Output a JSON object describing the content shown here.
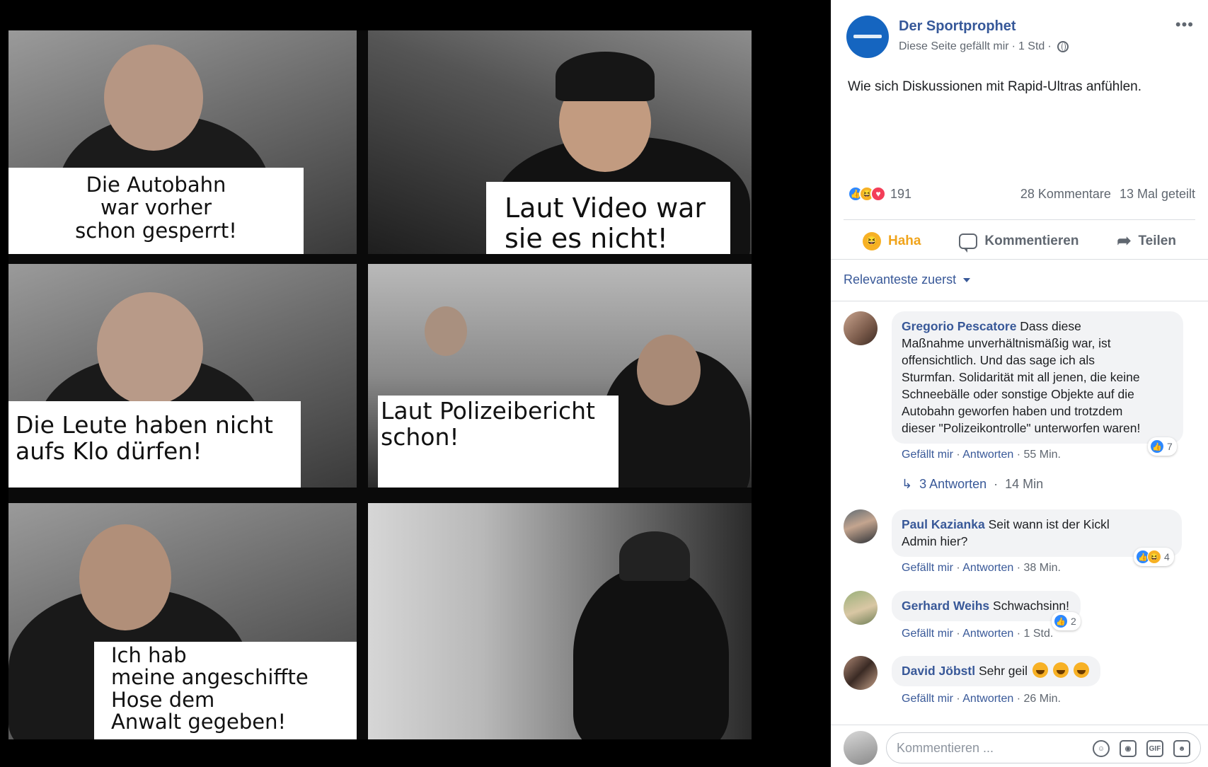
{
  "meme": {
    "captions": [
      {
        "lines": [
          "Die Autobahn",
          "war vorher",
          "schon gesperrt!"
        ]
      },
      {
        "lines": [
          "Laut Video war",
          "sie es nicht!"
        ]
      },
      {
        "lines": [
          "Die Leute haben nicht",
          "aufs Klo dürfen!"
        ]
      },
      {
        "lines": [
          "Laut Polizeibericht",
          "schon!"
        ]
      },
      {
        "lines": [
          "Ich hab",
          "meine angeschiffte",
          "Hose dem",
          "Anwalt gegeben!"
        ]
      }
    ]
  },
  "post": {
    "page_name": "Der Sportprophet",
    "like_page": "Diese Seite gefällt mir",
    "time": "1 Std",
    "text": "Wie sich Diskussionen mit Rapid-Ultras anfühlen.",
    "reaction_count": "191",
    "comment_count": "28 Kommentare",
    "share_count": "13 Mal geteilt"
  },
  "actions": {
    "haha": "Haha",
    "comment": "Kommentieren",
    "share": "Teilen"
  },
  "sort": "Relevanteste zuerst",
  "comments": [
    {
      "author": "Gregorio Pescatore",
      "lines": [
        "Dass diese",
        "Maßnahme unverhältnismäßig war, ist",
        "offensichtlich. Und das sage ich als",
        "Sturmfan. Solidarität mit all jenen, die keine",
        "Schneebälle oder sonstige Objekte auf die",
        "Autobahn geworfen haben und trotzdem",
        "dieser \"Polizeikontrolle\" unterworfen waren!"
      ],
      "like": "Gefällt mir",
      "reply": "Antworten",
      "time": "55 Min.",
      "reactions": "7",
      "replies": "3 Antworten",
      "replies_time": "14 Min"
    },
    {
      "author": "Paul Kazianka",
      "lines": [
        "Seit wann ist der Kickl",
        "Admin hier?"
      ],
      "like": "Gefällt mir",
      "reply": "Antworten",
      "time": "38 Min.",
      "reactions": "4"
    },
    {
      "author": "Gerhard Weihs",
      "lines": [
        "Schwachsinn!"
      ],
      "like": "Gefällt mir",
      "reply": "Antworten",
      "time": "1 Std.",
      "reactions": "2"
    },
    {
      "author": "David Jöbstl",
      "lines": [
        "Sehr geil"
      ],
      "like": "Gefällt mir",
      "reply": "Antworten",
      "time": "26 Min."
    }
  ],
  "composer": {
    "placeholder": "Kommentieren ..."
  },
  "icons": {
    "more": "more-horizontal-icon",
    "globe": "globe-icon",
    "haha": "haha-reaction-icon",
    "comment": "comment-icon",
    "share": "share-icon",
    "emoji": "emoji-icon",
    "camera": "camera-icon",
    "gif": "gif-icon",
    "sticker": "sticker-icon"
  },
  "colors": {
    "link": "#385898",
    "like": "#2d88ff",
    "haha": "#f7b125",
    "love": "#f33e58"
  }
}
